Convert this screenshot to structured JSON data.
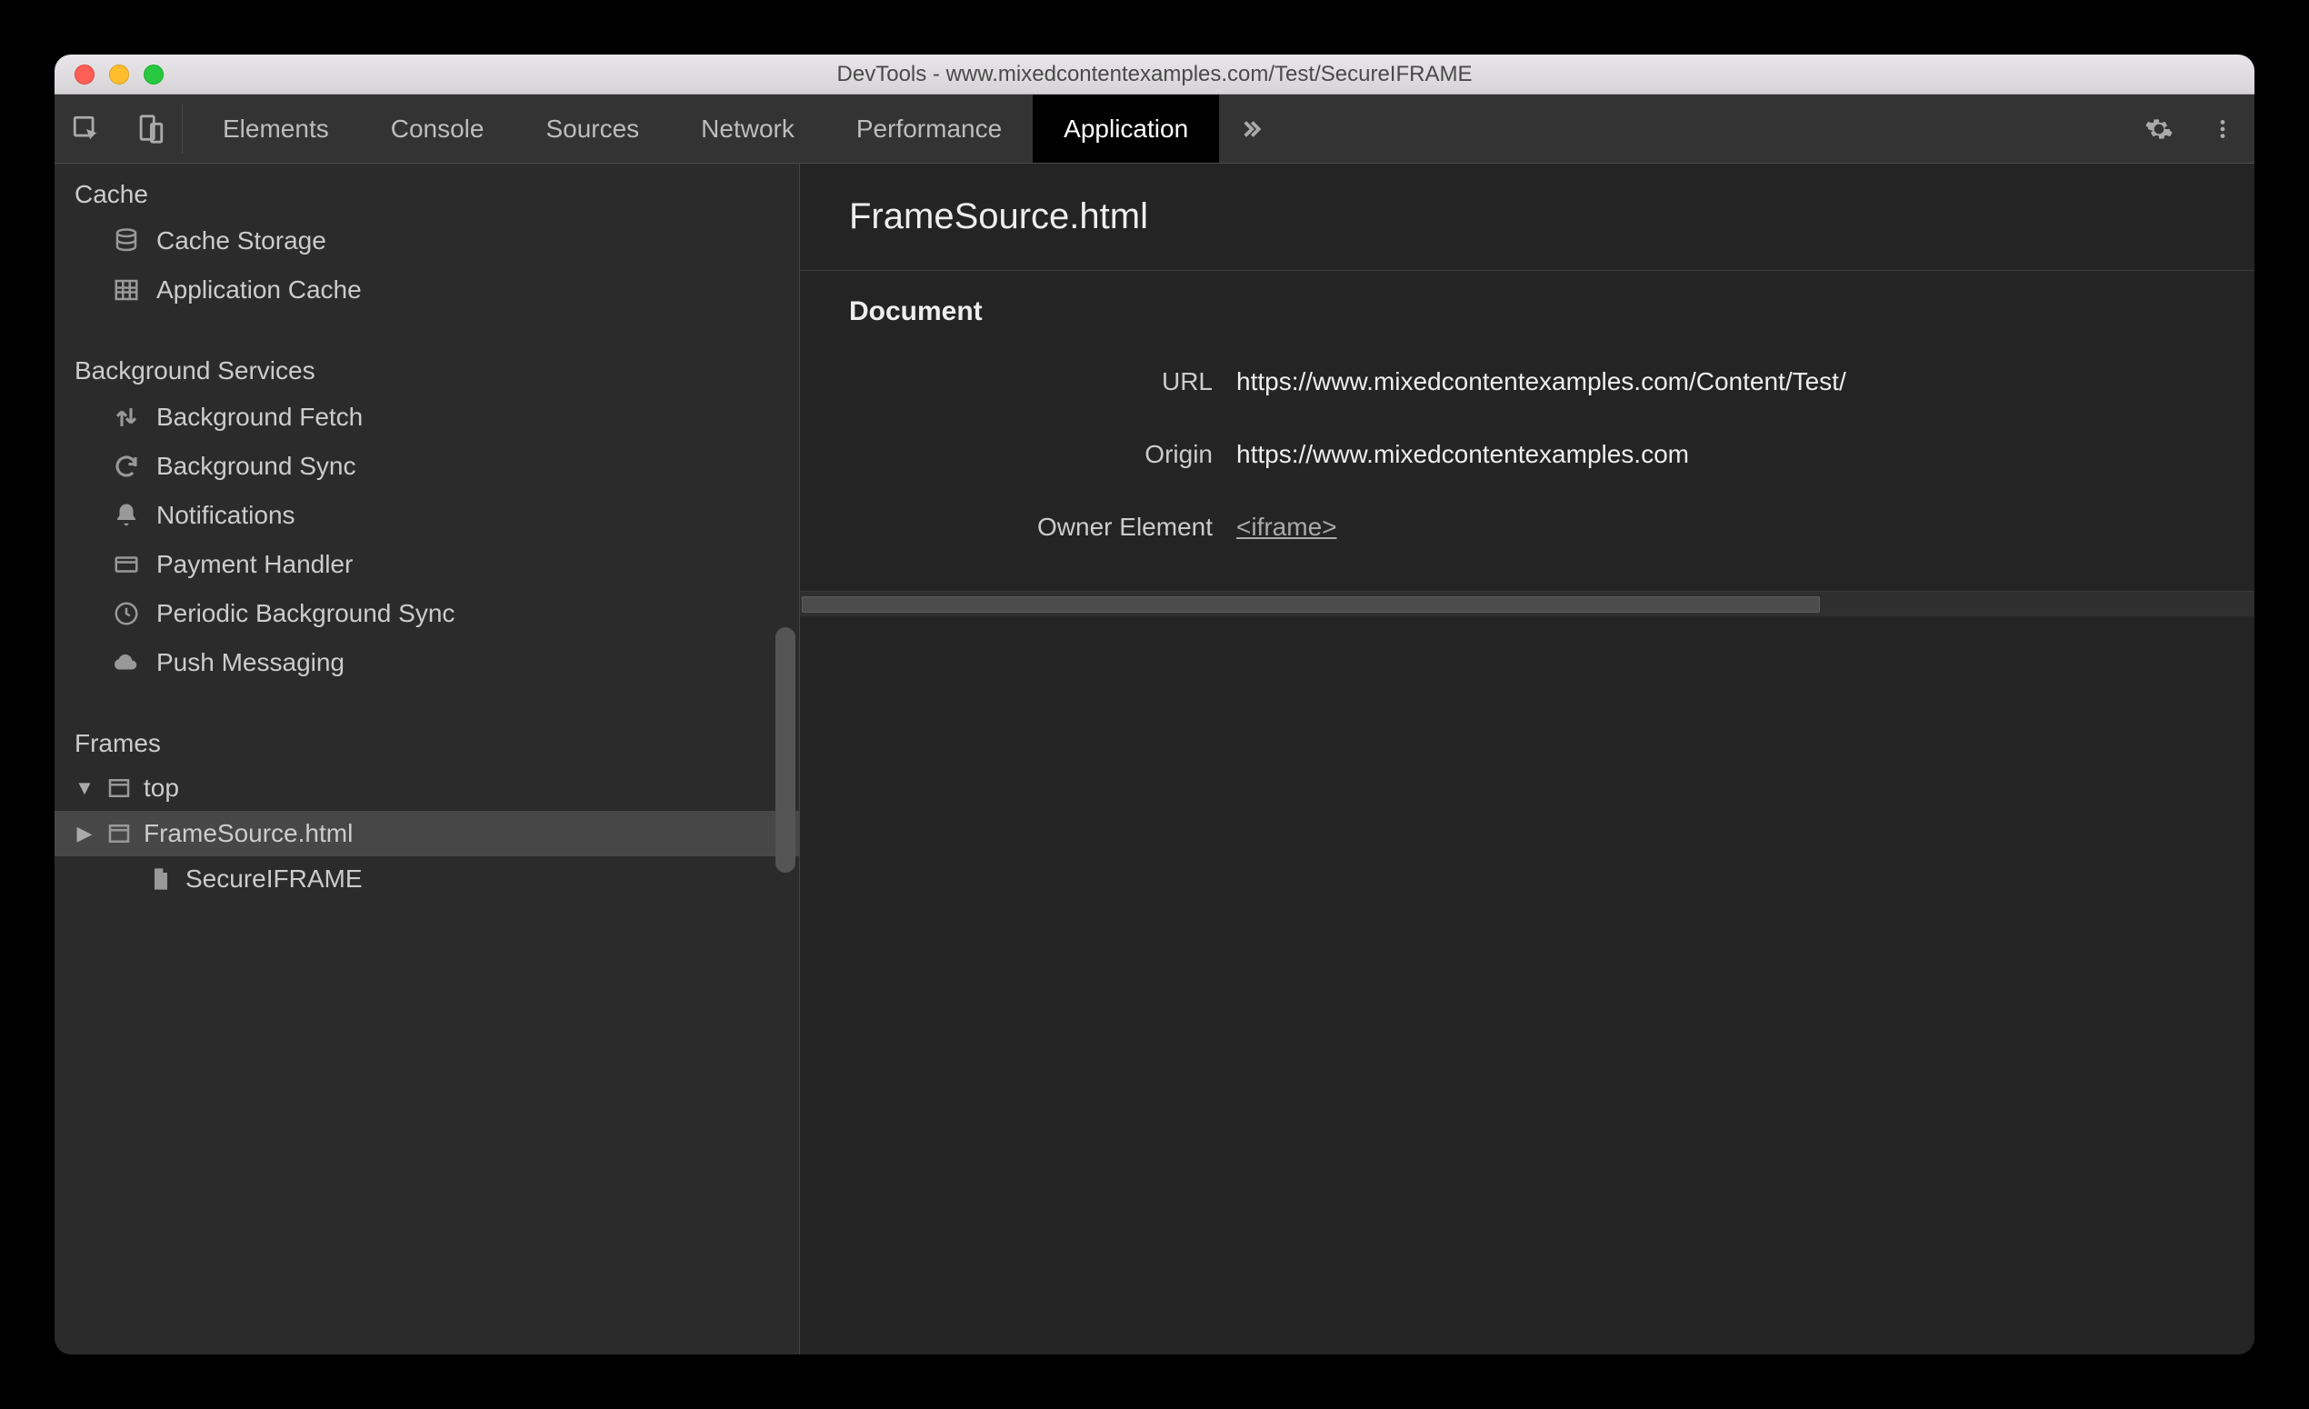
{
  "window": {
    "title": "DevTools - www.mixedcontentexamples.com/Test/SecureIFRAME"
  },
  "tabs": {
    "items": [
      "Elements",
      "Console",
      "Sources",
      "Network",
      "Performance",
      "Application"
    ],
    "active": "Application"
  },
  "sidebar": {
    "groups": [
      {
        "title": "Cache",
        "items": [
          {
            "label": "Cache Storage",
            "icon": "database"
          },
          {
            "label": "Application Cache",
            "icon": "grid"
          }
        ]
      },
      {
        "title": "Background Services",
        "items": [
          {
            "label": "Background Fetch",
            "icon": "updown"
          },
          {
            "label": "Background Sync",
            "icon": "sync"
          },
          {
            "label": "Notifications",
            "icon": "bell"
          },
          {
            "label": "Payment Handler",
            "icon": "card"
          },
          {
            "label": "Periodic Background Sync",
            "icon": "clock"
          },
          {
            "label": "Push Messaging",
            "icon": "cloud"
          }
        ]
      }
    ],
    "frames": {
      "title": "Frames",
      "tree": {
        "top_label": "top",
        "children": [
          {
            "label": "FrameSource.html",
            "icon": "frame",
            "selected": true,
            "expandable": true
          },
          {
            "label": "SecureIFRAME",
            "icon": "file",
            "selected": false,
            "expandable": false
          }
        ]
      }
    }
  },
  "main": {
    "title": "FrameSource.html",
    "section": "Document",
    "rows": [
      {
        "label": "URL",
        "value": "https://www.mixedcontentexamples.com/Content/Test/",
        "link": false
      },
      {
        "label": "Origin",
        "value": "https://www.mixedcontentexamples.com",
        "link": false
      },
      {
        "label": "Owner Element",
        "value": "<iframe>",
        "link": true
      }
    ]
  }
}
